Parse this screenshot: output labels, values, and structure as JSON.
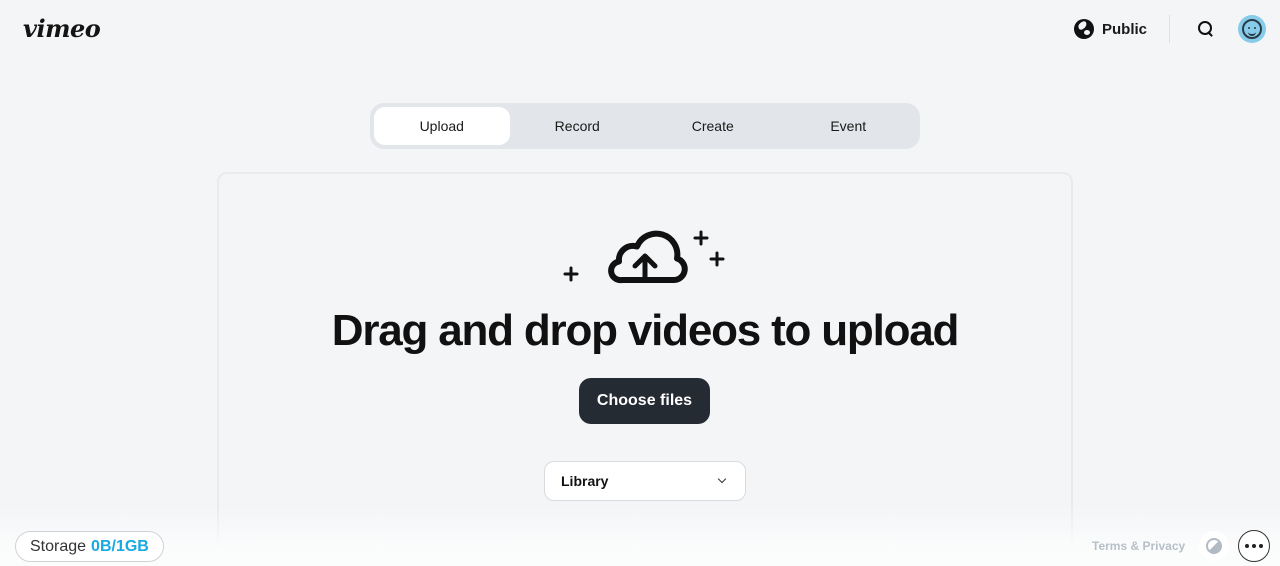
{
  "header": {
    "logo": "vimeo",
    "privacy_label": "Public",
    "privacy_icon": "globe-icon",
    "search_icon": "search-icon",
    "avatar_icon": "smiley-avatar-icon",
    "avatar_color": "#86cbea"
  },
  "tabs": [
    {
      "label": "Upload",
      "active": true
    },
    {
      "label": "Record",
      "active": false
    },
    {
      "label": "Create",
      "active": false
    },
    {
      "label": "Event",
      "active": false
    }
  ],
  "upload": {
    "icon": "cloud-upload-icon",
    "headline": "Drag and drop videos to upload",
    "choose_button": "Choose files",
    "destination_select": {
      "selected": "Library"
    }
  },
  "footer": {
    "storage_label": "Storage",
    "storage_value": "0B/1GB",
    "storage_color": "#17a9e1",
    "terms_link": "Terms & Privacy",
    "theme_icon": "theme-toggle-icon",
    "more_icon": "more-options-icon"
  }
}
